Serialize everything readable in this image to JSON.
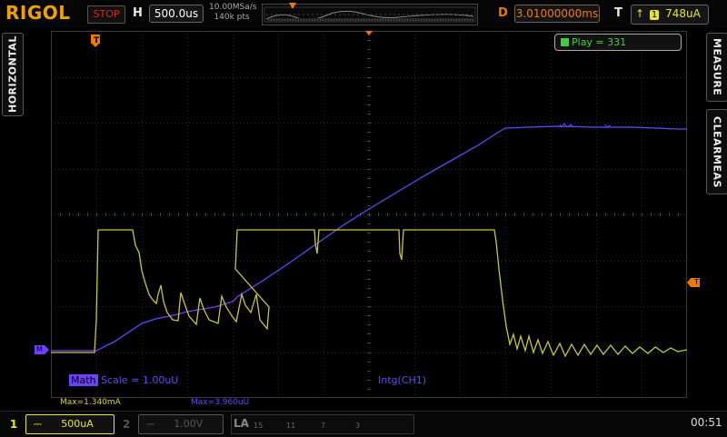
{
  "brand": "RIGOL",
  "run_state": "STOP",
  "timebase": {
    "label": "H",
    "value": "500.0us"
  },
  "acquisition": {
    "sample_rate": "10.00MSa/s",
    "memory_depth": "140k pts"
  },
  "delay": {
    "label": "D",
    "value": "3.01000000ms"
  },
  "trigger": {
    "label": "T",
    "source": "1",
    "level": "748uA"
  },
  "side_tabs": {
    "left": "HORIZONTAL",
    "right_top": "MEASURE",
    "right_bottom": "CLEARMEAS"
  },
  "play": {
    "text": "Play = 331"
  },
  "math": {
    "tag": "Math",
    "scale": "Scale = 1.00uU",
    "function": "Intg(CH1)"
  },
  "measurements": {
    "ch1_max": "Max=1.340mA",
    "math_max": "Max=3.960uU"
  },
  "channels": [
    {
      "num": "1",
      "coupling": "⎓",
      "scale": "500uA",
      "color": "#e8e820"
    },
    {
      "num": "2",
      "coupling": "⎓",
      "scale": "1.00V",
      "color": "#555555"
    }
  ],
  "la": {
    "label": "LA",
    "groups": [
      "15",
      "11",
      "7",
      "3"
    ]
  },
  "clock": "00:51",
  "markers": {
    "trigger_pos": "T",
    "ch1_marker": "T",
    "math_marker": "M"
  },
  "colors": {
    "ch1": "#d8d838",
    "math": "#7040ff",
    "trigger": "#f07a00",
    "brand": "#f2a000"
  }
}
